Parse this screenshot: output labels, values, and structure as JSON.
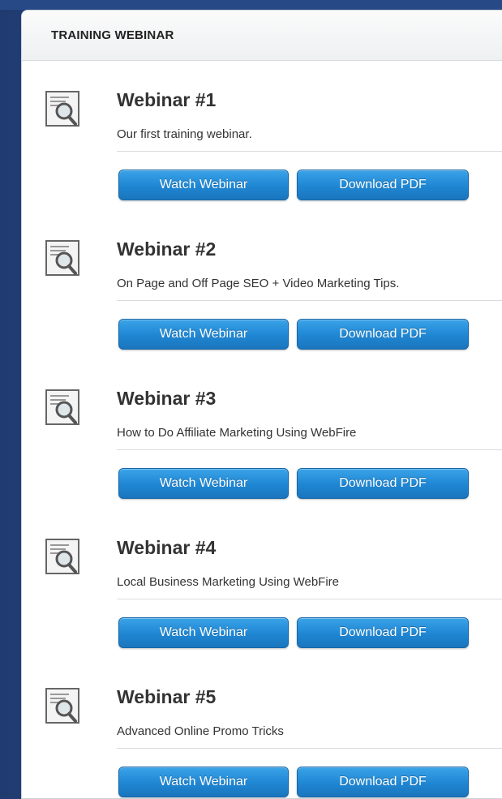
{
  "panel": {
    "title": "TRAINING WEBINAR"
  },
  "webinars": [
    {
      "title": "Webinar #1",
      "description": "Our first training webinar.",
      "watch_label": "Watch Webinar",
      "pdf_label": "Download PDF",
      "icon": "document-magnifier-icon"
    },
    {
      "title": "Webinar #2",
      "description": "On Page and Off Page SEO + Video Marketing Tips.",
      "watch_label": "Watch Webinar",
      "pdf_label": "Download PDF",
      "icon": "document-magnifier-icon"
    },
    {
      "title": "Webinar #3",
      "description": "How to Do Affiliate Marketing Using WebFire",
      "watch_label": "Watch Webinar",
      "pdf_label": "Download PDF",
      "icon": "document-magnifier-icon"
    },
    {
      "title": "Webinar #4",
      "description": "Local Business Marketing Using WebFire",
      "watch_label": "Watch Webinar",
      "pdf_label": "Download PDF",
      "icon": "document-magnifier-icon"
    },
    {
      "title": "Webinar #5",
      "description": "Advanced Online Promo Tricks",
      "watch_label": "Watch Webinar",
      "pdf_label": "Download PDF",
      "icon": "document-magnifier-icon"
    }
  ],
  "colors": {
    "button": "#1f86d3",
    "background": "#2d4f8c",
    "title_text": "#333333"
  }
}
